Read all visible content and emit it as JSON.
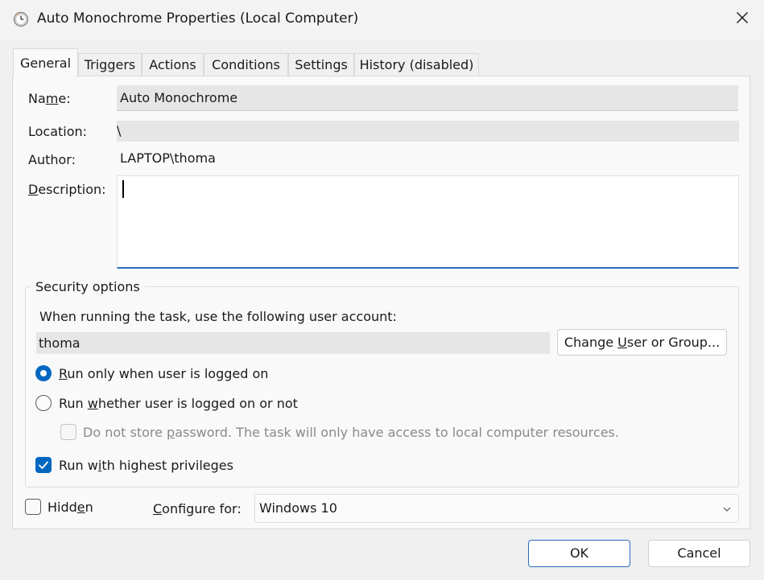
{
  "window": {
    "title": "Auto Monochrome Properties (Local Computer)",
    "icon": "clock-icon",
    "close_icon": "close-icon"
  },
  "tabs": [
    {
      "label": "General",
      "active": true
    },
    {
      "label": "Triggers",
      "active": false
    },
    {
      "label": "Actions",
      "active": false
    },
    {
      "label": "Conditions",
      "active": false
    },
    {
      "label": "Settings",
      "active": false
    },
    {
      "label": "History (disabled)",
      "active": false
    }
  ],
  "general": {
    "name_label_pre": "Na",
    "name_label_u": "m",
    "name_label_post": "e:",
    "name_value": "Auto Monochrome",
    "location_label": "Location:",
    "location_value": "\\",
    "author_label": "Author:",
    "author_value": "LAPTOP\\thoma",
    "description_label_u": "D",
    "description_label_post": "escription:",
    "description_value": ""
  },
  "security": {
    "title": "Security options",
    "account_prompt": "When running the task, use the following user account:",
    "account_value": "thoma",
    "change_button_pre": "Change ",
    "change_button_u": "U",
    "change_button_post": "ser or Group...",
    "radio_logged_on": {
      "u": "R",
      "rest": "un only when user is logged on",
      "selected": true
    },
    "radio_whether": {
      "pre": "Run ",
      "u": "w",
      "rest": "hether user is logged on or not",
      "selected": false
    },
    "do_not_store": {
      "pre": "Do not store ",
      "u": "p",
      "rest": "assword.  The task will only have access to local computer resources.",
      "checked": false,
      "disabled": true
    },
    "highest_privileges": {
      "pre": "Run w",
      "u": "i",
      "rest": "th highest privileges",
      "checked": true
    }
  },
  "bottom": {
    "hidden": {
      "pre": "Hidd",
      "u": "e",
      "rest": "n",
      "checked": false
    },
    "configure_label_u": "C",
    "configure_label_rest": "onfigure for:",
    "configure_value": "Windows 10"
  },
  "buttons": {
    "ok": "OK",
    "cancel": "Cancel"
  },
  "colors": {
    "accent": "#0067c0",
    "focus_border": "#2b6cbf",
    "window_bg": "#f0f0f0"
  }
}
